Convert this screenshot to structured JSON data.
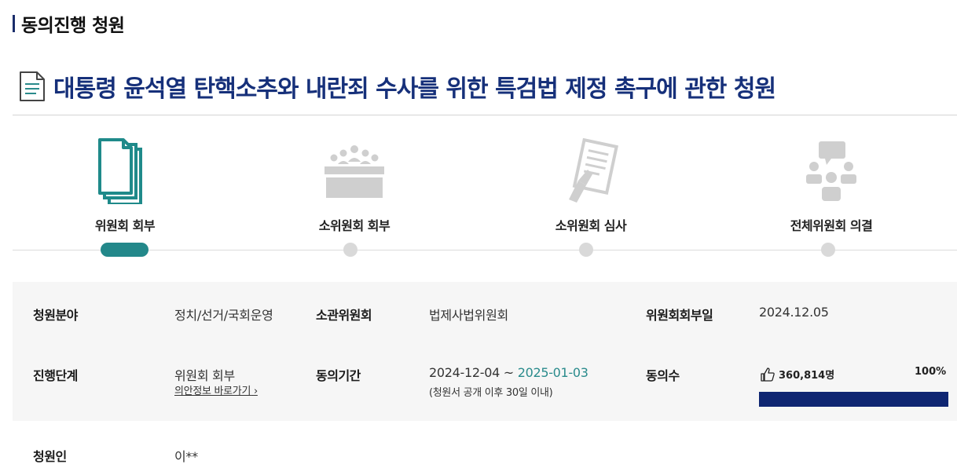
{
  "section": {
    "title": "동의진행 청원"
  },
  "petition": {
    "title": "대통령 윤석열 탄핵소추와 내란죄 수사를 위한 특검법 제정 촉구에 관한 청원"
  },
  "steps": [
    {
      "label": "위원회 회부",
      "icon": "documents-icon",
      "active": true
    },
    {
      "label": "소위원회 회부",
      "icon": "meeting-icon",
      "active": false
    },
    {
      "label": "소위원회 심사",
      "icon": "review-icon",
      "active": false
    },
    {
      "label": "전체위원회 의결",
      "icon": "discussion-icon",
      "active": false
    }
  ],
  "colors": {
    "accent": "#23888a",
    "title_navy": "#16307a",
    "progress": "#0f2672",
    "inactive": "#d9d9d9"
  },
  "info": {
    "field_label": "청원분야",
    "field_value": "정치/선거/국회운영",
    "committee_label": "소관위원회",
    "committee_value": "법제사법위원회",
    "referral_label": "위원회회부일",
    "referral_value": "2024.12.05",
    "stage_label": "진행단계",
    "stage_value": "위원회 회부",
    "stage_link": "의안정보 바로가기",
    "period_label": "동의기간",
    "period_start": "2024-12-04",
    "period_sep": " ~ ",
    "period_end": "2025-01-03",
    "period_note": "(청원서 공개 이후 30일 이내)",
    "agree_label": "동의수",
    "agree_count": "360,814명",
    "agree_percent": "100%",
    "agree_progress": 1.0
  },
  "petitioner": {
    "label": "청원인",
    "value": "이**"
  }
}
